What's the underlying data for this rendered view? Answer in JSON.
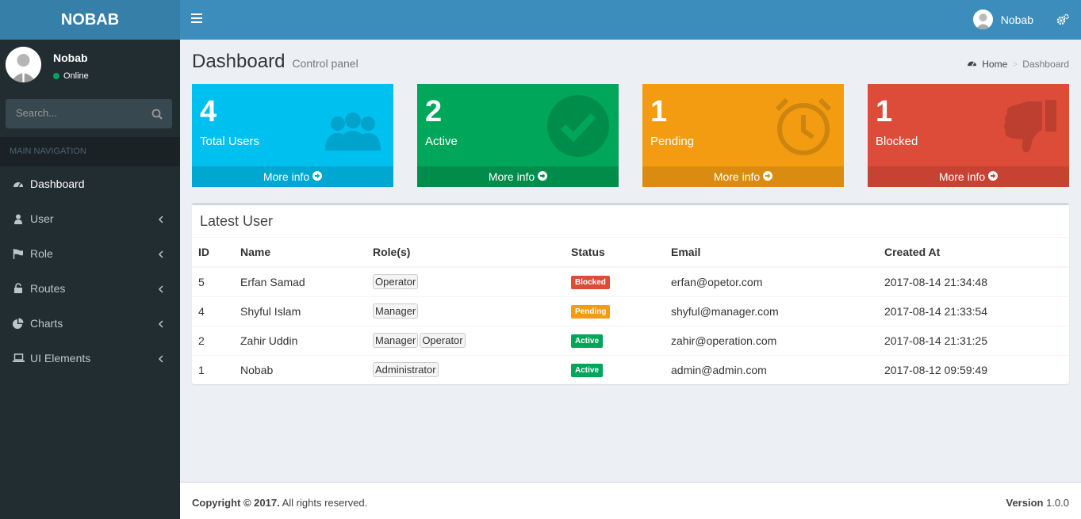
{
  "app": {
    "logo": "NOBAB"
  },
  "navbar": {
    "user_name": "Nobab"
  },
  "sidebar": {
    "user_name": "Nobab",
    "status": "Online",
    "search_placeholder": "Search...",
    "nav_header": "MAIN NAVIGATION",
    "items": [
      {
        "label": "Dashboard",
        "icon": "dashboard-icon"
      },
      {
        "label": "User",
        "icon": "user-icon"
      },
      {
        "label": "Role",
        "icon": "flag-icon"
      },
      {
        "label": "Routes",
        "icon": "unlock-icon"
      },
      {
        "label": "Charts",
        "icon": "pie-chart-icon"
      },
      {
        "label": "UI Elements",
        "icon": "laptop-icon"
      }
    ]
  },
  "header": {
    "title": "Dashboard",
    "subtitle": "Control panel",
    "breadcrumb": [
      "Home",
      "Dashboard"
    ]
  },
  "boxes": [
    {
      "value": "4",
      "label": "Total Users",
      "more": "More info",
      "color": "#00c0ef",
      "footer_color": "#00a7d0",
      "icon": "users-icon"
    },
    {
      "value": "2",
      "label": "Active",
      "more": "More info",
      "color": "#00a65a",
      "footer_color": "#008d4c",
      "icon": "check-circle-icon"
    },
    {
      "value": "1",
      "label": "Pending",
      "more": "More info",
      "color": "#f39c12",
      "footer_color": "#da8c10",
      "icon": "alarm-clock-icon"
    },
    {
      "value": "1",
      "label": "Blocked",
      "more": "More info",
      "color": "#dd4b39",
      "footer_color": "#c64333",
      "icon": "thumbs-down-icon"
    }
  ],
  "latest": {
    "title": "Latest User",
    "columns": [
      "ID",
      "Name",
      "Role(s)",
      "Status",
      "Email",
      "Created At"
    ],
    "rows": [
      {
        "id": "5",
        "name": "Erfan Samad",
        "roles": [
          "Operator"
        ],
        "status": "Blocked",
        "status_color": "#dd4b39",
        "email": "erfan@opetor.com",
        "created": "2017-08-14 21:34:48"
      },
      {
        "id": "4",
        "name": "Shyful Islam",
        "roles": [
          "Manager"
        ],
        "status": "Pending",
        "status_color": "#f39c12",
        "email": "shyful@manager.com",
        "created": "2017-08-14 21:33:54"
      },
      {
        "id": "2",
        "name": "Zahir Uddin",
        "roles": [
          "Manager",
          "Operator"
        ],
        "status": "Active",
        "status_color": "#00a65a",
        "email": "zahir@operation.com",
        "created": "2017-08-14 21:31:25"
      },
      {
        "id": "1",
        "name": "Nobab",
        "roles": [
          "Administrator"
        ],
        "status": "Active",
        "status_color": "#00a65a",
        "email": "admin@admin.com",
        "created": "2017-08-12 09:59:49"
      }
    ]
  },
  "footer": {
    "copyright": "Copyright © 2017.",
    "rights": "All rights reserved.",
    "version_label": "Version",
    "version": "1.0.0"
  }
}
